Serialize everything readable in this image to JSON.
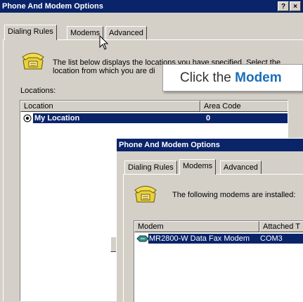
{
  "back_window": {
    "title": "Phone And Modem Options",
    "help_button": "?",
    "close_button": "×",
    "tabs": [
      "Dialing Rules",
      "Modems",
      "Advanced"
    ],
    "description_line1": "The list below displays the locations you have specified. Select the",
    "description_line2": "location from which you are di",
    "locations_label": "Locations:",
    "columns": [
      "Location",
      "Area Code"
    ],
    "rows": [
      {
        "location": "My Location",
        "area_code": "0",
        "selected": true
      }
    ]
  },
  "callout": {
    "prefix": "Click the ",
    "emphasis": "Modem"
  },
  "front_window": {
    "title": "Phone And Modem Options",
    "tabs": [
      "Dialing Rules",
      "Modems",
      "Advanced"
    ],
    "installed_text": "The following modems are installed:",
    "columns": [
      "Modem",
      "Attached T"
    ],
    "rows": [
      {
        "modem": "MR2800-W Data Fax Modem",
        "attached_to": "COM3",
        "selected": true
      }
    ]
  },
  "colors": {
    "title_bar": "#0a246a",
    "selection": "#0a246a",
    "callout_emphasis": "#1a6fb8",
    "face": "#d4d0c8"
  },
  "icons": [
    "phone-icon",
    "modem-icon",
    "mouse-pointer-icon",
    "radio-selected-icon"
  ]
}
